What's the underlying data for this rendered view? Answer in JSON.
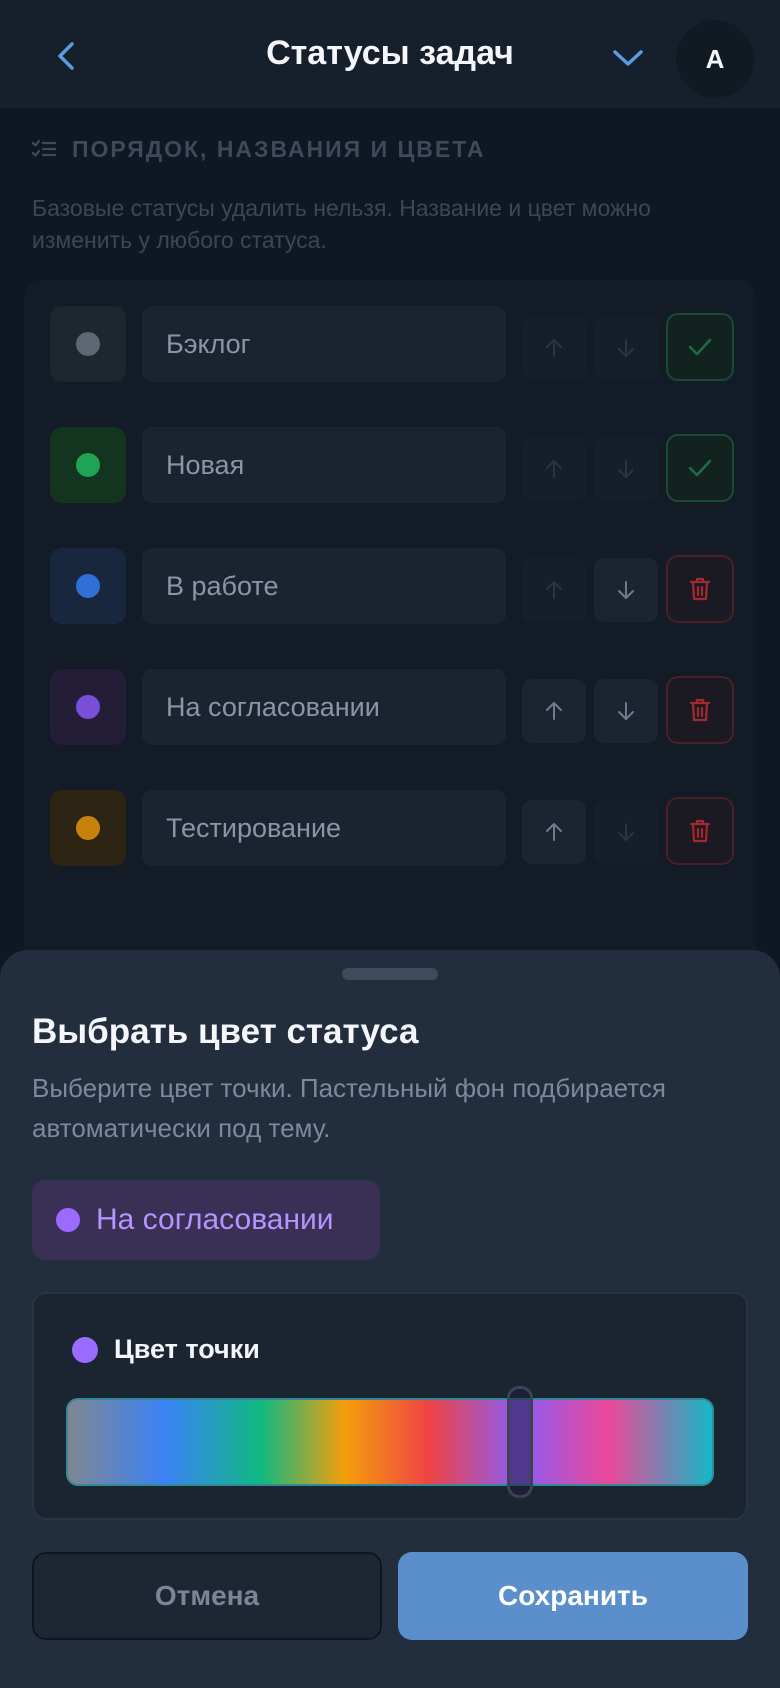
{
  "header": {
    "title": "Статусы задач",
    "avatar_initial": "A",
    "back_icon": "chevron-left-icon",
    "menu_icon": "chevron-down-icon",
    "accent": "#5b9be0"
  },
  "section": {
    "title": "ПОРЯДОК, НАЗВАНИЯ И ЦВЕТА",
    "icon": "checklist-icon",
    "description": "Базовые статусы удалить нельзя. Название и цвет можно изменить у любого статуса."
  },
  "statuses": [
    {
      "name": "Бэклог",
      "dot_color": "#5d6673",
      "bg_color": "#1e2630",
      "up_enabled": false,
      "down_enabled": false,
      "action": "base"
    },
    {
      "name": "Новая",
      "dot_color": "#1fa354",
      "bg_color": "#13351f",
      "up_enabled": false,
      "down_enabled": false,
      "action": "base"
    },
    {
      "name": "В работе",
      "dot_color": "#2f6fd6",
      "bg_color": "#18273d",
      "up_enabled": false,
      "down_enabled": true,
      "action": "delete"
    },
    {
      "name": "На согласовании",
      "dot_color": "#7a4fd8",
      "bg_color": "#231d38",
      "up_enabled": true,
      "down_enabled": true,
      "action": "delete"
    },
    {
      "name": "Тестирование",
      "dot_color": "#c5830b",
      "bg_color": "#2e2414",
      "up_enabled": true,
      "down_enabled": false,
      "action": "delete"
    }
  ],
  "sheet": {
    "title": "Выбрать цвет статуса",
    "description": "Выберите цвет точки. Пастельный фон подбирается автоматически под тему.",
    "preview_label": "На согласовании",
    "dot_label": "Цвет точки",
    "selected_color": "#9b6bff",
    "hue_position": 0.7,
    "cancel_label": "Отмена",
    "save_label": "Сохранить"
  }
}
